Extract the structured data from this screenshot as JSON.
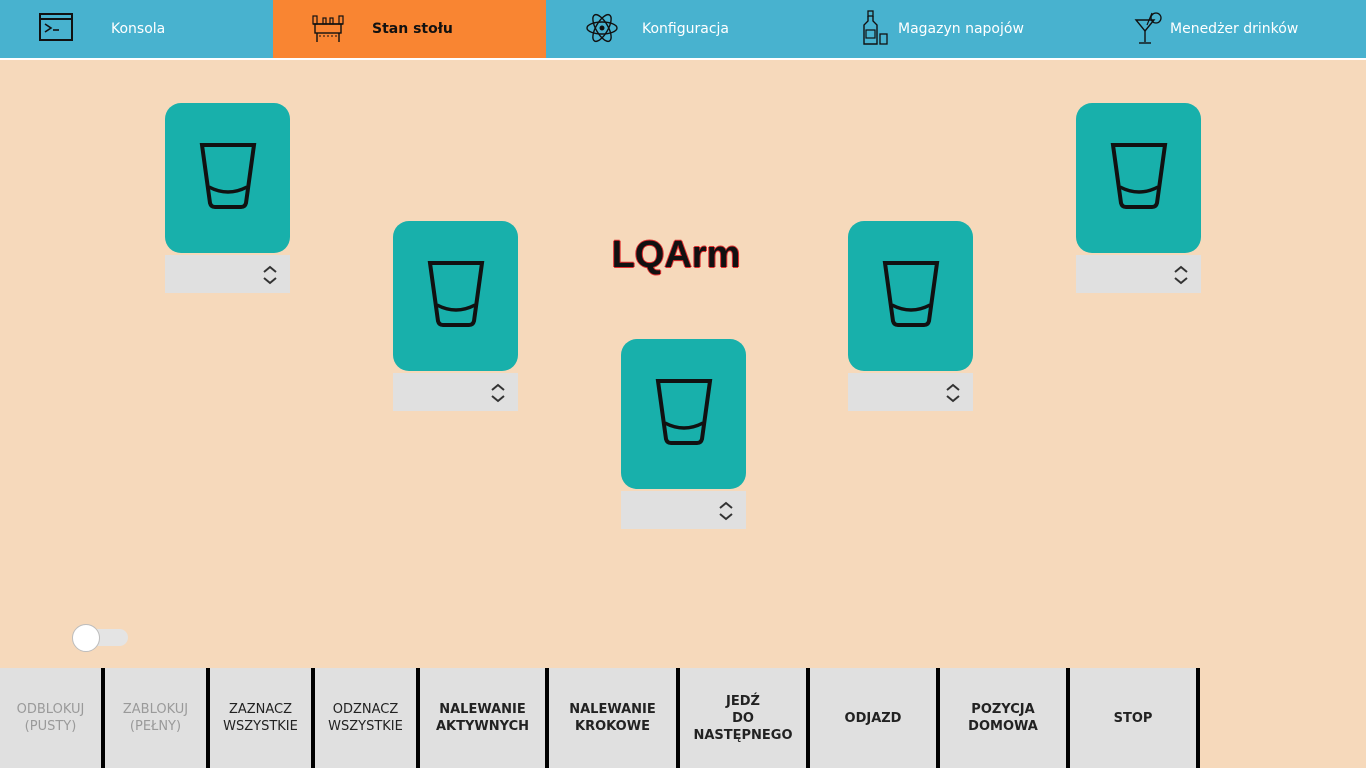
{
  "nav": {
    "tabs": [
      {
        "label": "Konsola",
        "icon": "console-icon",
        "active": false
      },
      {
        "label": "Stan stołu",
        "icon": "table-icon",
        "active": true
      },
      {
        "label": "Konfiguracja",
        "icon": "atom-icon",
        "active": false
      },
      {
        "label": "Magazyn napojów",
        "icon": "bottle-icon",
        "active": false
      },
      {
        "label": "Menedżer drinków",
        "icon": "cocktail-icon",
        "active": false
      }
    ]
  },
  "title": "LQArm",
  "slots": [
    {
      "icon": "shot-glass-icon",
      "value": ""
    },
    {
      "icon": "shot-glass-icon",
      "value": ""
    },
    {
      "icon": "shot-glass-icon",
      "value": ""
    },
    {
      "icon": "shot-glass-icon",
      "value": ""
    },
    {
      "icon": "shot-glass-icon",
      "value": ""
    }
  ],
  "toggle": {
    "on": false
  },
  "buttons": [
    {
      "label": "ODBLOKUJ\n(PUSTY)",
      "enabled": false
    },
    {
      "label": "ZABLOKUJ\n(PEŁNY)",
      "enabled": false
    },
    {
      "label": "ZAZNACZ\nWSZYSTKIE",
      "enabled": true
    },
    {
      "label": "ODZNACZ\nWSZYSTKIE",
      "enabled": true
    },
    {
      "label": "NALEWANIE\nAKTYWNYCH",
      "enabled": true
    },
    {
      "label": "NALEWANIE\nKROKOWE",
      "enabled": true
    },
    {
      "label": "JEDŹ\nDO\nNASTĘPNEGO",
      "enabled": true
    },
    {
      "label": "ODJAZD",
      "enabled": true
    },
    {
      "label": "POZYCJA\nDOMOWA",
      "enabled": true
    },
    {
      "label": "STOP",
      "enabled": true
    }
  ],
  "colors": {
    "nav_bg": "#48b2cf",
    "nav_active": "#f98532",
    "page_bg": "#f6d9bb",
    "glass_card": "#18b0ab",
    "button_bg": "#e0e0e0"
  }
}
